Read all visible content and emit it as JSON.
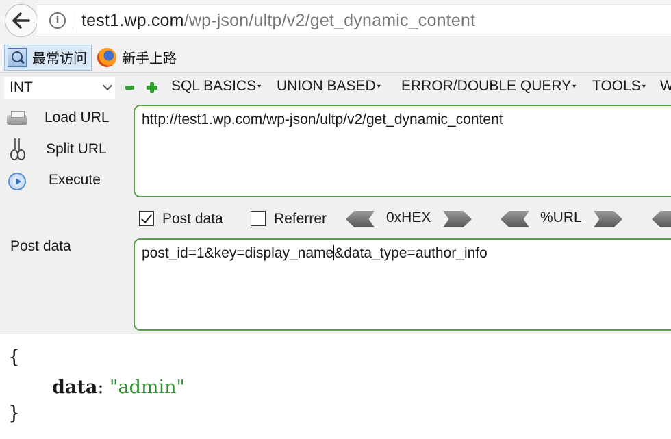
{
  "address_bar": {
    "url_host": "test1.wp.com",
    "url_path": "/wp-json/ultp/v2/get_dynamic_content"
  },
  "bookmarks": [
    {
      "label": "最常访问",
      "icon": "magnifier-icon"
    },
    {
      "label": "新手上路",
      "icon": "firefox-icon"
    }
  ],
  "hackbar": {
    "select_value": "INT",
    "menus": [
      "SQL BASICS",
      "UNION BASED",
      "ERROR/DOUBLE QUERY",
      "TOOLS",
      "W"
    ],
    "side_buttons": {
      "load": "Load URL",
      "split": "Split URL",
      "execute": "Execute"
    },
    "url_value": "http://test1.wp.com/wp-json/ultp/v2/get_dynamic_content",
    "options": {
      "post_data": {
        "label": "Post data",
        "checked": true
      },
      "referrer": {
        "label": "Referrer",
        "checked": false
      },
      "hex": "0xHEX",
      "url_encode": "%URL"
    },
    "post_label": "Post data",
    "post_value_before_cursor": "post_id=1&key=display_name",
    "post_value_after_cursor": "&data_type=author_info"
  },
  "response": {
    "open_brace": "{",
    "key": "data",
    "colon": ":",
    "value": "\"admin\"",
    "close_brace": "}"
  },
  "colors": {
    "textbox_border": "#5aa04a",
    "icon_green": "#2ea12e",
    "json_value": "#2f8a2f"
  }
}
